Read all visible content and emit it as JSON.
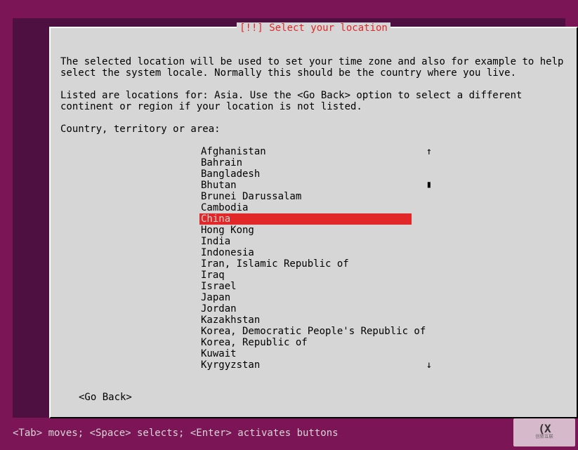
{
  "dialog": {
    "title_prefix": "[!!] ",
    "title": "Select your location"
  },
  "text": {
    "para1": "The selected location will be used to set your time zone and also for example to help select the system locale. Normally this should be the country where you live.",
    "para2": "Listed are locations for: Asia. Use the <Go Back> option to select a different continent or region if your location is not listed.",
    "prompt": "Country, territory or area:"
  },
  "countries": [
    "Afghanistan",
    "Bahrain",
    "Bangladesh",
    "Bhutan",
    "Brunei Darussalam",
    "Cambodia",
    "China",
    "Hong Kong",
    "India",
    "Indonesia",
    "Iran, Islamic Republic of",
    "Iraq",
    "Israel",
    "Japan",
    "Jordan",
    "Kazakhstan",
    "Korea, Democratic People's Republic of",
    "Korea, Republic of",
    "Kuwait",
    "Kyrgyzstan"
  ],
  "selected_index": 6,
  "go_back": "<Go Back>",
  "footer": "<Tab> moves; <Space> selects; <Enter> activates buttons",
  "scroll": {
    "up": "↑",
    "mid": "▮",
    "down": "↓"
  },
  "watermark": {
    "logo": "(X",
    "text": "创新互联"
  }
}
